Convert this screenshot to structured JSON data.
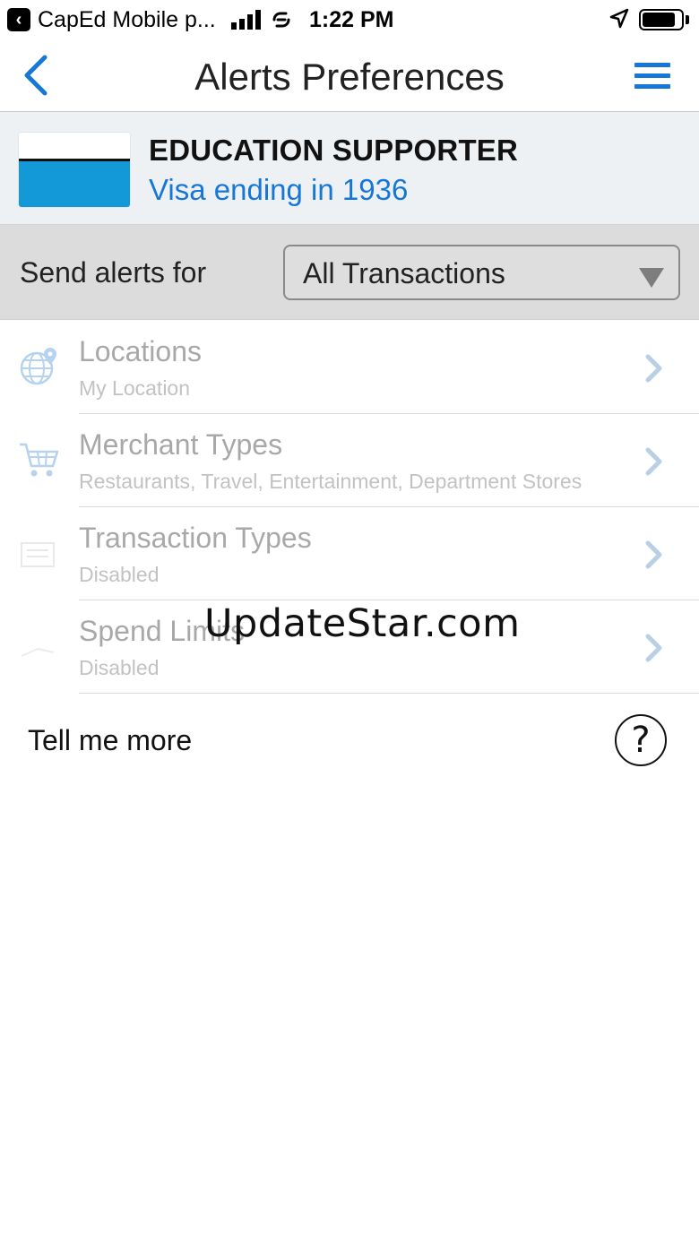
{
  "status_bar": {
    "back_app_label": "CapEd Mobile p...",
    "time": "1:22 PM",
    "battery_level": 0.85
  },
  "nav": {
    "title": "Alerts Preferences"
  },
  "card": {
    "name": "EDUCATION SUPPORTER",
    "subtitle": "Visa ending in 1936",
    "colors": {
      "stripe": "#1499d8",
      "link": "#1677d6"
    }
  },
  "alerts": {
    "label": "Send alerts for",
    "selected": "All Transactions"
  },
  "list": {
    "items": [
      {
        "title": "Locations",
        "subtitle": "My Location",
        "icon": "globe-icon"
      },
      {
        "title": "Merchant Types",
        "subtitle": "Restaurants, Travel, Entertainment, Department Stores",
        "icon": "shopping-cart-icon"
      },
      {
        "title": "Transaction Types",
        "subtitle": "Disabled",
        "icon": "transaction-types-icon"
      },
      {
        "title": "Spend Limits",
        "subtitle": "Disabled",
        "icon": "spend-limits-icon"
      }
    ]
  },
  "help": {
    "label": "Tell me more",
    "icon_glyph": "?"
  },
  "watermark": "UpdateStar.com"
}
